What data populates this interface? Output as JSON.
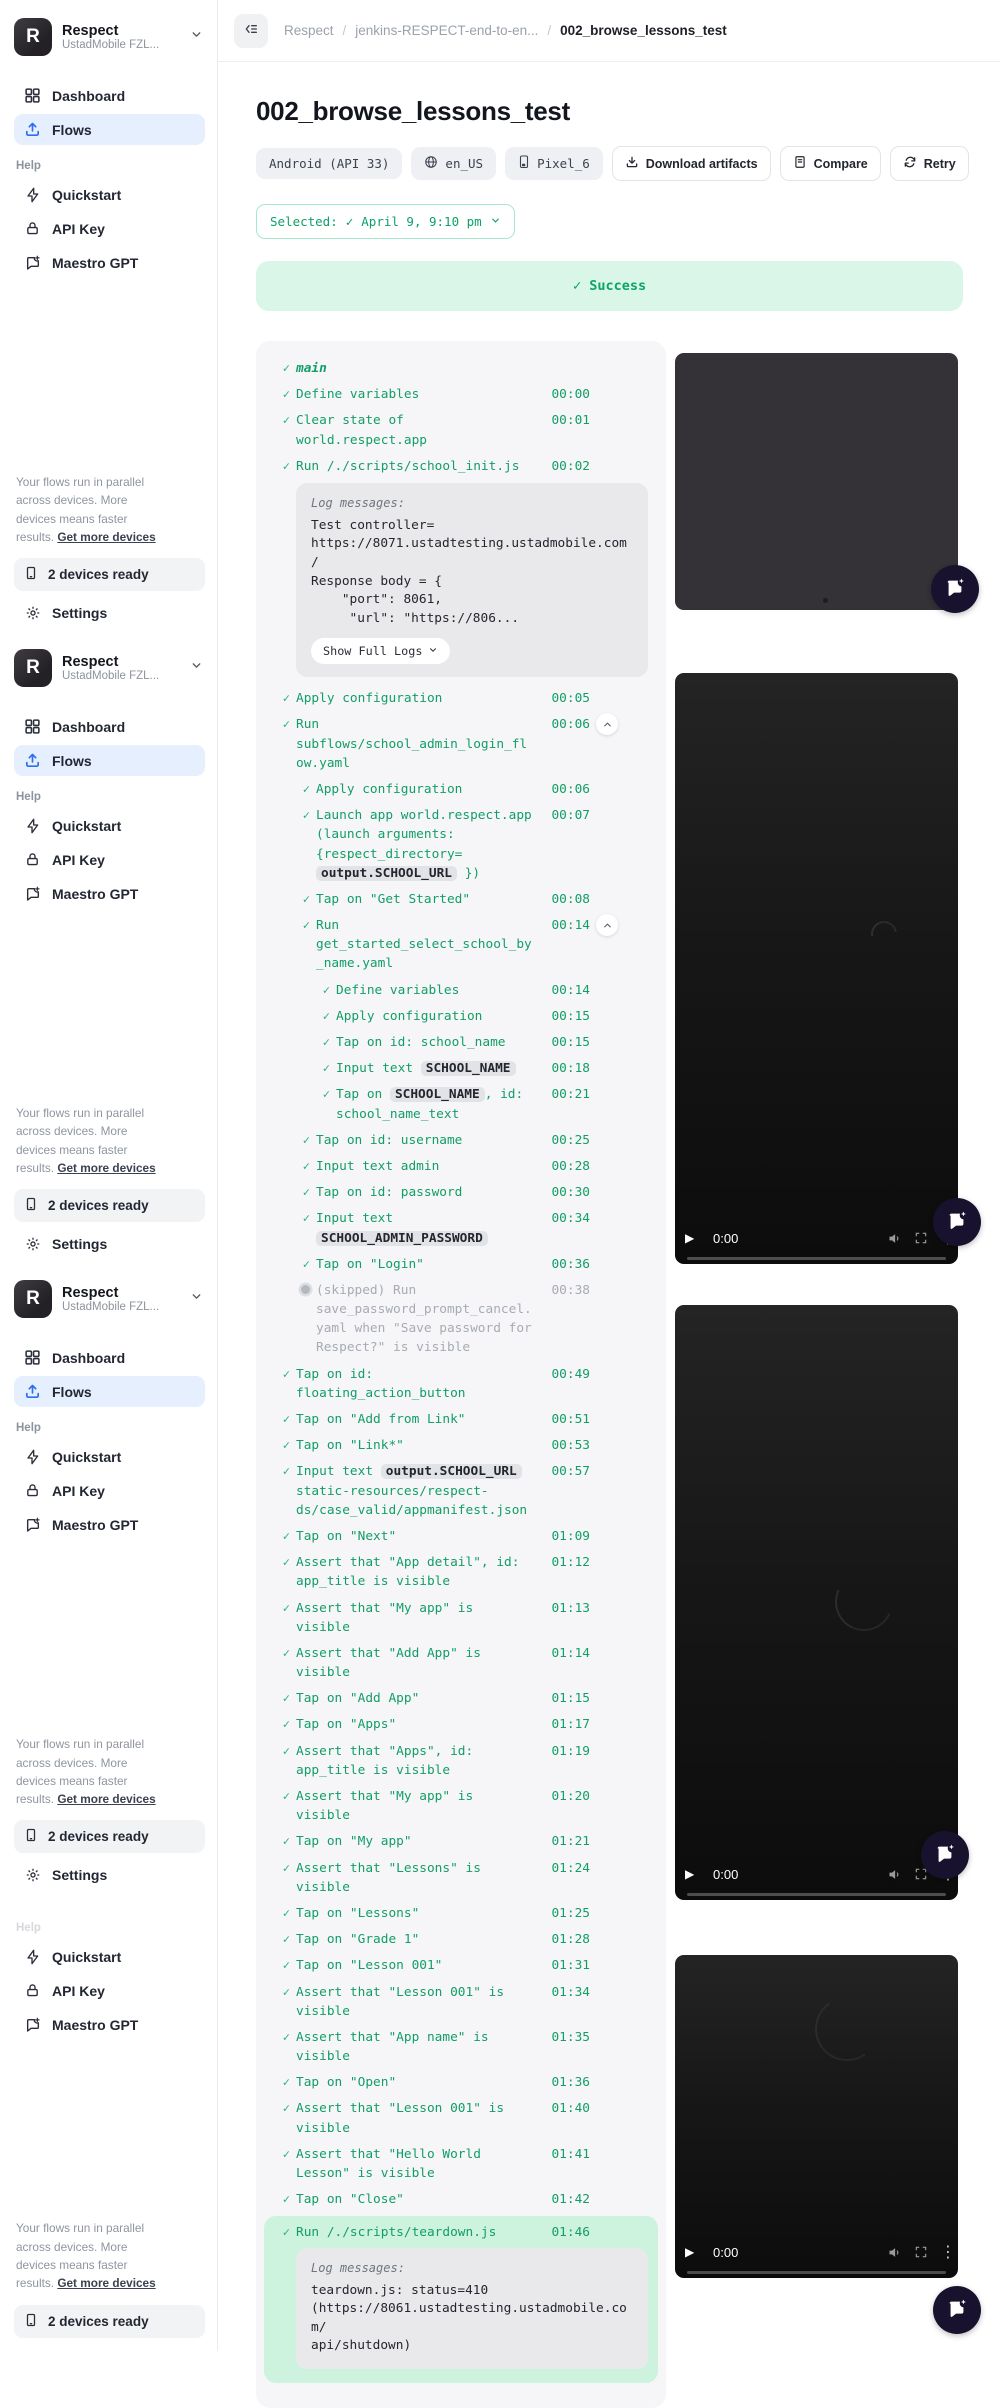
{
  "sidebar": {
    "workspace": {
      "logo_letter": "R",
      "name": "Respect",
      "org": "UstadMobile FZL..."
    },
    "nav": {
      "dashboard": "Dashboard",
      "flows": "Flows"
    },
    "help_label": "Help",
    "help": {
      "quickstart": "Quickstart",
      "api_key": "API Key",
      "maestro_gpt": "Maestro GPT"
    },
    "note": {
      "text": "Your flows run in parallel across devices. More devices means faster results. ",
      "link": "Get more devices"
    },
    "devices_ready": "2 devices ready",
    "settings": "Settings"
  },
  "header": {
    "breadcrumb": [
      "Respect",
      "jenkins-RESPECT-end-to-en...",
      "002_browse_lessons_test"
    ]
  },
  "page": {
    "title": "002_browse_lessons_test",
    "badges": [
      {
        "icon": "none",
        "label": "Android (API 33)"
      },
      {
        "icon": "globe",
        "label": "en_US"
      },
      {
        "icon": "device",
        "label": "Pixel_6"
      }
    ],
    "actions": [
      {
        "icon": "download",
        "label": "Download artifacts"
      },
      {
        "icon": "compare",
        "label": "Compare"
      },
      {
        "icon": "retry",
        "label": "Retry"
      }
    ],
    "selected": {
      "prefix": "Selected:",
      "value": "April 9, 9:10 pm"
    },
    "status": "Success"
  },
  "steps": [
    {
      "level": 0,
      "icon": "check",
      "variant": "title",
      "segments": [
        [
          "t",
          "main"
        ]
      ],
      "time": ""
    },
    {
      "level": 0,
      "icon": "check",
      "segments": [
        [
          "t",
          "Define variables"
        ]
      ],
      "time": "00:00"
    },
    {
      "level": 0,
      "icon": "check",
      "segments": [
        [
          "t",
          "Clear state of world.respect.app"
        ]
      ],
      "time": "00:01"
    },
    {
      "level": 0,
      "icon": "check",
      "segments": [
        [
          "t",
          "Run /./scripts/school_init.js"
        ]
      ],
      "time": "00:02",
      "log": {
        "label": "Log messages:",
        "text": "Test controller=\nhttps://8071.ustadtesting.ustadmobile.com/\nResponse body = {\n    \"port\": 8061,\n     \"url\": \"https://806...",
        "button": "Show Full Logs"
      }
    },
    {
      "level": 0,
      "icon": "check",
      "segments": [
        [
          "t",
          "Apply configuration"
        ]
      ],
      "time": "00:05"
    },
    {
      "level": 0,
      "icon": "check",
      "segments": [
        [
          "t",
          "Run subflows/school_admin_login_flow.yaml"
        ]
      ],
      "time": "00:06",
      "collapse": true
    },
    {
      "level": 1,
      "icon": "check",
      "segments": [
        [
          "t",
          "Apply configuration"
        ]
      ],
      "time": "00:06"
    },
    {
      "level": 1,
      "icon": "check",
      "segments": [
        [
          "t",
          "Launch app world.respect.app (launch arguments: {respect_directory= "
        ],
        [
          "c",
          "output.SCHOOL_URL"
        ],
        [
          "t",
          " })"
        ]
      ],
      "time": "00:07"
    },
    {
      "level": 1,
      "icon": "check",
      "segments": [
        [
          "t",
          "Tap on \"Get Started\""
        ]
      ],
      "time": "00:08"
    },
    {
      "level": 1,
      "icon": "check",
      "segments": [
        [
          "t",
          "Run get_started_select_school_by_name.yaml"
        ]
      ],
      "time": "00:14",
      "collapse": true
    },
    {
      "level": 2,
      "icon": "check",
      "segments": [
        [
          "t",
          "Define variables"
        ]
      ],
      "time": "00:14"
    },
    {
      "level": 2,
      "icon": "check",
      "segments": [
        [
          "t",
          "Apply configuration"
        ]
      ],
      "time": "00:15"
    },
    {
      "level": 2,
      "icon": "check",
      "segments": [
        [
          "t",
          "Tap on id: school_name"
        ]
      ],
      "time": "00:15"
    },
    {
      "level": 2,
      "icon": "check",
      "segments": [
        [
          "t",
          "Input text "
        ],
        [
          "c",
          "SCHOOL_NAME"
        ]
      ],
      "time": "00:18"
    },
    {
      "level": 2,
      "icon": "check",
      "segments": [
        [
          "t",
          "Tap on "
        ],
        [
          "c",
          "SCHOOL_NAME"
        ],
        [
          "t",
          ", id: school_name_text"
        ]
      ],
      "time": "00:21"
    },
    {
      "level": 1,
      "icon": "check",
      "segments": [
        [
          "t",
          "Tap on id: username"
        ]
      ],
      "time": "00:25"
    },
    {
      "level": 1,
      "icon": "check",
      "segments": [
        [
          "t",
          "Input text admin"
        ]
      ],
      "time": "00:28"
    },
    {
      "level": 1,
      "icon": "check",
      "segments": [
        [
          "t",
          "Tap on id: password"
        ]
      ],
      "time": "00:30"
    },
    {
      "level": 1,
      "icon": "check",
      "segments": [
        [
          "t",
          "Input text "
        ],
        [
          "c",
          "SCHOOL_ADMIN_PASSWORD"
        ]
      ],
      "time": "00:34"
    },
    {
      "level": 1,
      "icon": "check",
      "segments": [
        [
          "t",
          "Tap on \"Login\""
        ]
      ],
      "time": "00:36"
    },
    {
      "level": 1,
      "icon": "skip",
      "segments": [
        [
          "t",
          "(skipped) Run save_password_prompt_cancel.yaml when \"Save password for Respect?\" is visible"
        ]
      ],
      "time": "00:38"
    },
    {
      "level": 0,
      "icon": "check",
      "segments": [
        [
          "t",
          "Tap on id: floating_action_button"
        ]
      ],
      "time": "00:49"
    },
    {
      "level": 0,
      "icon": "check",
      "segments": [
        [
          "t",
          "Tap on \"Add from Link\""
        ]
      ],
      "time": "00:51"
    },
    {
      "level": 0,
      "icon": "check",
      "segments": [
        [
          "t",
          "Tap on \"Link*\""
        ]
      ],
      "time": "00:53"
    },
    {
      "level": 0,
      "icon": "check",
      "segments": [
        [
          "t",
          "Input text "
        ],
        [
          "c",
          "output.SCHOOL_URL"
        ],
        [
          "t",
          " static-resources/respect-ds/case_valid/appmanifest.json"
        ]
      ],
      "time": "00:57"
    },
    {
      "level": 0,
      "icon": "check",
      "segments": [
        [
          "t",
          "Tap on \"Next\""
        ]
      ],
      "time": "01:09"
    },
    {
      "level": 0,
      "icon": "check",
      "segments": [
        [
          "t",
          "Assert that \"App detail\", id: app_title is visible"
        ]
      ],
      "time": "01:12"
    },
    {
      "level": 0,
      "icon": "check",
      "segments": [
        [
          "t",
          "Assert that \"My app\" is visible"
        ]
      ],
      "time": "01:13"
    },
    {
      "level": 0,
      "icon": "check",
      "segments": [
        [
          "t",
          "Assert that \"Add App\" is visible"
        ]
      ],
      "time": "01:14"
    },
    {
      "level": 0,
      "icon": "check",
      "segments": [
        [
          "t",
          "Tap on \"Add App\""
        ]
      ],
      "time": "01:15"
    },
    {
      "level": 0,
      "icon": "check",
      "segments": [
        [
          "t",
          "Tap on \"Apps\""
        ]
      ],
      "time": "01:17"
    },
    {
      "level": 0,
      "icon": "check",
      "segments": [
        [
          "t",
          "Assert that \"Apps\", id: app_title is visible"
        ]
      ],
      "time": "01:19"
    },
    {
      "level": 0,
      "icon": "check",
      "segments": [
        [
          "t",
          "Assert that \"My app\" is visible"
        ]
      ],
      "time": "01:20"
    },
    {
      "level": 0,
      "icon": "check",
      "segments": [
        [
          "t",
          "Tap on \"My app\""
        ]
      ],
      "time": "01:21"
    },
    {
      "level": 0,
      "icon": "check",
      "segments": [
        [
          "t",
          "Assert that \"Lessons\" is visible"
        ]
      ],
      "time": "01:24"
    },
    {
      "level": 0,
      "icon": "check",
      "segments": [
        [
          "t",
          "Tap on \"Lessons\""
        ]
      ],
      "time": "01:25"
    },
    {
      "level": 0,
      "icon": "check",
      "segments": [
        [
          "t",
          "Tap on \"Grade 1\""
        ]
      ],
      "time": "01:28"
    },
    {
      "level": 0,
      "icon": "check",
      "segments": [
        [
          "t",
          "Tap on \"Lesson 001\""
        ]
      ],
      "time": "01:31"
    },
    {
      "level": 0,
      "icon": "check",
      "segments": [
        [
          "t",
          "Assert that \"Lesson 001\" is visible"
        ]
      ],
      "time": "01:34"
    },
    {
      "level": 0,
      "icon": "check",
      "segments": [
        [
          "t",
          "Assert that \"App name\" is visible"
        ]
      ],
      "time": "01:35"
    },
    {
      "level": 0,
      "icon": "check",
      "segments": [
        [
          "t",
          "Tap on \"Open\""
        ]
      ],
      "time": "01:36"
    },
    {
      "level": 0,
      "icon": "check",
      "segments": [
        [
          "t",
          "Assert that \"Lesson 001\" is visible"
        ]
      ],
      "time": "01:40"
    },
    {
      "level": 0,
      "icon": "check",
      "segments": [
        [
          "t",
          "Assert that \"Hello World Lesson\" is visible"
        ]
      ],
      "time": "01:41"
    },
    {
      "level": 0,
      "icon": "check",
      "segments": [
        [
          "t",
          "Tap on \"Close\""
        ]
      ],
      "time": "01:42"
    },
    {
      "level": 0,
      "icon": "check",
      "segments": [
        [
          "t",
          "Run /./scripts/teardown.js"
        ]
      ],
      "time": "01:46",
      "highlight": true,
      "log": {
        "label": "Log messages:",
        "text": "teardown.js: status=410\n(https://8061.ustadtesting.ustadmobile.com/\napi/shutdown)"
      }
    }
  ],
  "videos": {
    "players": [
      {
        "time": "0:00"
      },
      {
        "time": "0:00"
      },
      {
        "time": "0:00"
      }
    ]
  },
  "colors": {
    "accent_green": "#129e66",
    "success_bg": "#d9f6e8",
    "active_nav_bg": "#e6effd",
    "flows_icon_blue": "#2e6ff2"
  }
}
